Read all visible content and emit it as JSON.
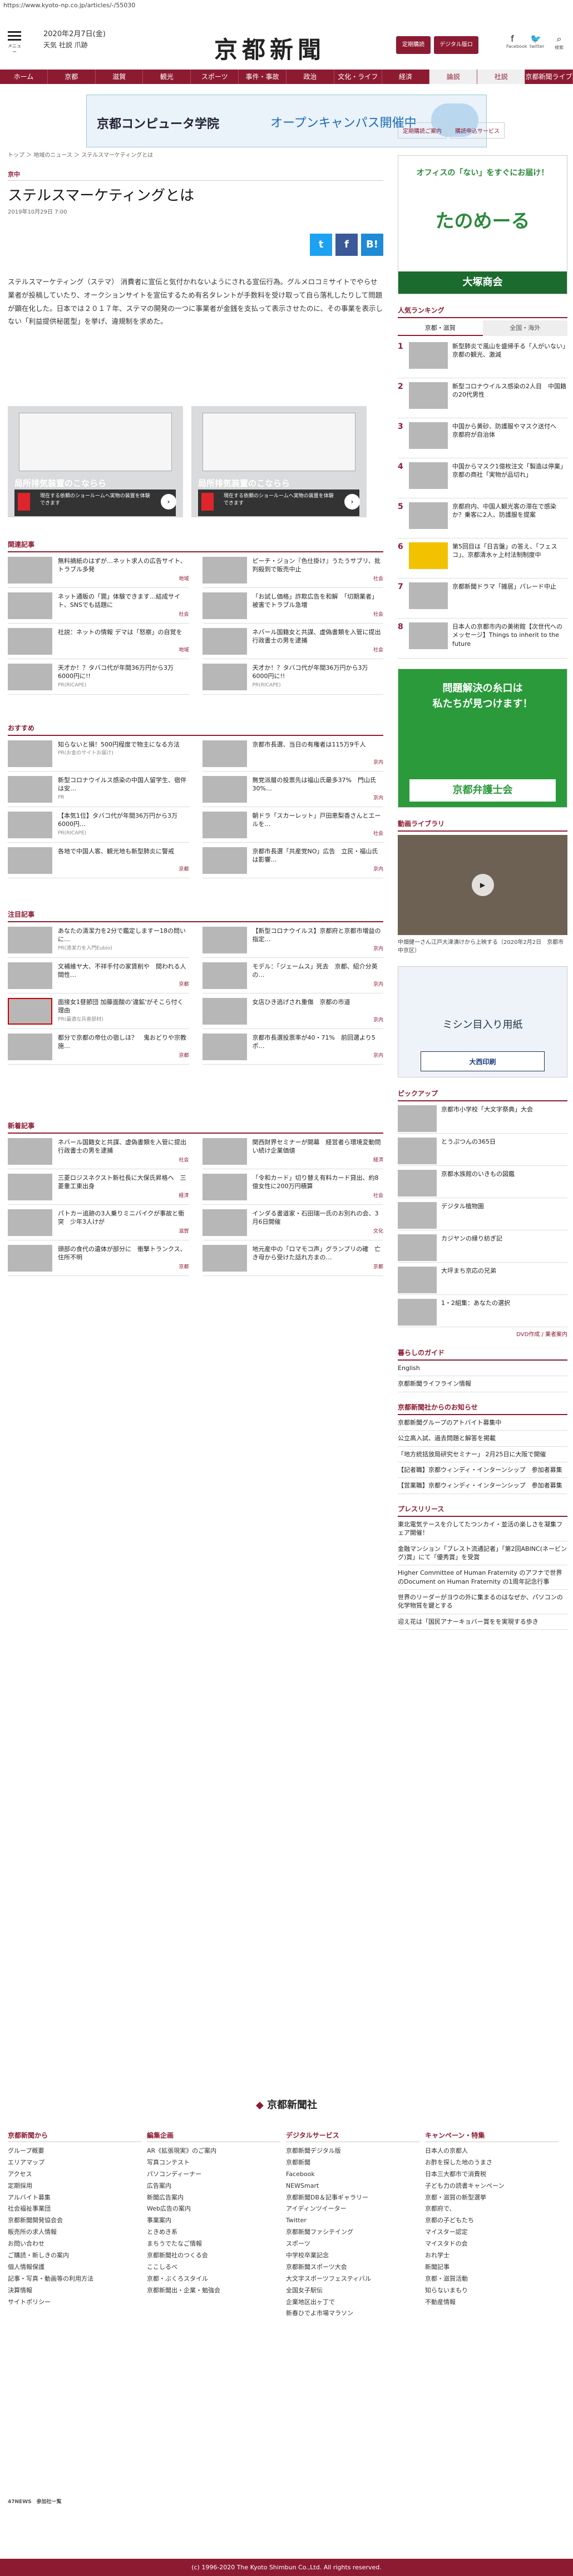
{
  "url": "https://www.kyoto-np.co.jp/articles/-/55030",
  "header": {
    "date": "2020年2月7日(金)",
    "weather": "天気 社説 爪跡",
    "logo": "京都新聞",
    "btn1": "定期購読",
    "btn2": "デジタル版ログイン",
    "menu": "メニュー",
    "icons": [
      "Facebook",
      "twitter",
      "検索"
    ]
  },
  "nav": [
    "ホーム",
    "京都",
    "滋賀",
    "観光",
    "スポーツ",
    "事件・事故",
    "政治",
    "文化・ライフ",
    "経済",
    "論説",
    "社説",
    "京都新聞ライブ"
  ],
  "banner": {
    "school": "京都コンピュータ学院",
    "event": "オープンキャンパス開催中"
  },
  "breadcrumb": "トップ ＞ 地域のニュース ＞ ステルスマーケティングとは",
  "category": "京中",
  "title": "ステルスマーケティングとは",
  "pubdate": "2019年10月29日 7:00",
  "share": [
    "t",
    "f",
    "B!"
  ],
  "body": "ステルスマーケティング（ステマ） 消費者に宣伝と気付かれないようにされる宣伝行為。グルメロコミサイトでやらせ業者が投稿していたり、オークションサイトを宣伝するため有名タレントが手数料を受け取って自ら落札したりして問題が顕在化した。日本では２０１７年、ステマの開発の一つに事業者が金銭を支払って表示させたのに、その事業を表示しない「利益提供秘匿型」を挙げ、違規制を求めた。",
  "ads": [
    {
      "title": "局所排気装置のこならら",
      "desc": "現在する依頼のショールームへ実物の装置を体験できます"
    },
    {
      "title": "局所排気装置のこならら",
      "desc": "現在する依頼のショールームへ実物の装置を体験できます"
    }
  ],
  "related_title": "関連記事",
  "related": [
    {
      "t": "無料摘紙のはずが…ネット求人の広告サイト、トラブル多発",
      "tag": "地域"
    },
    {
      "t": "ピーチ・ジョン『色仕掛け』うたうサブリ、批判殺到で販売中止",
      "tag": "社会"
    },
    {
      "t": "ネット通販の「罠」体験できます…結成サイト、SNSでも話題に",
      "tag": "社会"
    },
    {
      "t": "「お試し価格」詐欺広告を和解　「切期業者」被害でトラブル急増",
      "tag": "社会"
    },
    {
      "t": "社説：ネットの情報 デマは「怒察」の自覚を",
      "tag": "地域"
    },
    {
      "t": "ネバール国籍女と共謀、虚偽書類を入管に提出　行政書士の男を逮捕",
      "tag": "社会"
    },
    {
      "t": "天才か！？タバコ代が年間36万円から3万6000円に!!",
      "tag": "PR(RICAPE)"
    },
    {
      "t": "天才か！？タバコ代が年間36万円から3万6000円に!!",
      "tag": "PR(RICAPE)"
    }
  ],
  "osusume_title": "おすすめ",
  "osusume": [
    {
      "t": "知らないと損！500円程度で物主になる方法",
      "tag": "PR(お金のサイトお届け)"
    },
    {
      "t": "京都市長選、当日の有権者は115万9千人",
      "tag": "京内"
    },
    {
      "t": "新型コロナウイルス感染の中国人留学生、宿伴は安…",
      "tag": "PR"
    },
    {
      "t": "無党派層の投票先は福山氏最多37%　門山氏30%…",
      "tag": "京内"
    },
    {
      "t": "【本気1位】タバコ代が年間36万円から3万6000円…",
      "tag": "PR(RICAPE)"
    },
    {
      "t": "朝ドラ「スカーレット」戸田恵梨香さんとエールを…",
      "tag": "社会"
    },
    {
      "t": "各地で中国人客、観光地も新型肺炎に警戒",
      "tag": "京都"
    },
    {
      "t": "京都市長選「共産党NO」広告　立民・福山氏は影響…",
      "tag": "京内"
    }
  ],
  "chumoku_title": "注目記事",
  "chumoku": [
    {
      "t": "あなたの清潔力を2分で鑑定しますー18の問いに…",
      "tag": "PR(清潔力を入門Eubio)"
    },
    {
      "t": "【新型コロナウイルス】京都府と京都市増益の指定…",
      "tag": "京内"
    },
    {
      "t": "文補維ヤ大、不祥手付の家賃削や　間われる人間性…",
      "tag": "京都"
    },
    {
      "t": "モデル：「ジェームス」死去　京都、紹介分英の…",
      "tag": "京内"
    },
    {
      "t": "面接女1昼節団 加藤面酸の'違鉱'がそこら付く理由",
      "tag": "PR(最適な兵喜部材)"
    },
    {
      "t": "女店ひき逃げされ重傷　京都の市道",
      "tag": "京内"
    },
    {
      "t": "都分で京都の帝仕の宿しほ？　鬼おどりや宗教施…",
      "tag": "京都"
    },
    {
      "t": "京都市長選投票率が40・71%　前回選より5ポ…",
      "tag": "京内"
    }
  ],
  "shinchaku_title": "新着記事",
  "shinchaku": [
    {
      "t": "ネバール国籍女と共謀、虚偽書類を入管に提出　行政書士の男を逮捕",
      "tag": "社会"
    },
    {
      "t": "関西財界セミナーが開幕　経営者ら環境変動問い続け企業価値",
      "tag": "経済"
    },
    {
      "t": "三菱ロジスネクスト新社長に大保氏昇格へ　三菱重工東出身",
      "tag": "経済"
    },
    {
      "t": "「令和カード」切り替え有料カード貸出、約8億女性に200万円積算",
      "tag": "社会"
    },
    {
      "t": "パトカー追跡の3人乗りミニバイクが事故と衝突　少年3人けが",
      "tag": "滋賀"
    },
    {
      "t": "インダる書道家・石田瑞一氏のお別れの会、3月6日開催",
      "tag": "文化"
    },
    {
      "t": "頭部の食代の遺体が部分に　衝撃トランクス、住所不明",
      "tag": "京都"
    },
    {
      "t": "地元産中の「ロマモコ声」グランプリの確　亡き母から受けた話れ方まの…",
      "tag": "京都"
    }
  ],
  "side": {
    "btns": [
      "定期購読ご案内",
      "購読申込サービス"
    ],
    "ad1": {
      "top": "オフィスの「ない」をすぐにお届け！",
      "brand": "たのめーる",
      "corp": "大塚商会"
    },
    "rank_title": "人気ランキング",
    "rank_tabs": [
      "京都・滋賀",
      "全国・海外"
    ],
    "rank": [
      "新型肺炎で風山を盛帰手る「人がいない」　京都の観光、激減",
      "新型コロナウイルス感染の2人目　中国籍の20代男性",
      "中国から黄砂、防護服やマスク送付へ　京都府が自治体",
      "中国からマスク1億枚注文「製造は停業」京都の商社「実物が品切れ」",
      "京都府内、中国人観光客の滞在で感染か？乗客に2人、防護服を提案",
      "第5回目は「日吉盤」の答え、「フェスコ」、京都清水ヶ上村法制制度中",
      "京都新聞ドラマ「雑居」パレード中止",
      "日本人の京都市内の美術館【次世代へのメッセージ】Things to inherit to the future"
    ],
    "ad2": {
      "t1": "問題解決の糸口は",
      "t2": "私たちが見つけます！",
      "t3": "京都弁護士会"
    },
    "video_title": "動画ライブラリ",
    "video_cap": "中畑健一さん江戸大津漬けから上映する（2020年2月2日　京都市中京区）",
    "ad3": {
      "t1": "ミシン目入り用紙",
      "t2": "大西印刷"
    },
    "pickup_title": "ピックアップ",
    "pickup": [
      "京都市小学校「大文字祭典」大会",
      "とうぷつんの365日",
      "京都水族館のいきもの図鑑",
      "デジタル植物園",
      "カジヤンの縁り紡ぎ記",
      "大坪まち京応の兄弟",
      "1・2組集：あなたの選択"
    ],
    "pickup_extra": "DVD作成 / 業者案内",
    "kurashi_title": "暮らしのガイド",
    "kurashi": [
      "English",
      "京都新聞ライフライン情報"
    ],
    "kyoto_title": "京都新聞社からのお知らせ",
    "kyoto": [
      "京都新聞グループのアトバイト募集中",
      "公立高入試、過去問題と解答を掲載",
      "「地方統括放局研究セミナー」 2月25日に大阪で開催",
      "【記者職】京都ウィンディ・インターンシップ　参加者募集",
      "【営業職】京都ウィンディ・インターンシップ　参加者募集"
    ],
    "press_title": "プレスリリース",
    "press": [
      "東北電気テースを介してたつンカイ・並活の楽しさを凝集フェア開催！",
      "金融マンション「ブレスト流通記者」「第2回ABINC(ネービング)賞」にて「優秀賞」を受賞",
      "Higher Committee of Human Fraternity のアフナで世界のDocument on Human Fraternity の1周年記念行事",
      "世界のリーダーがヨウの外に集まるのはなぜか、パソコンの化学物質を鍵とする",
      "迎え花は「国民アナーキョバー賞をを実現する歩き"
    ]
  },
  "footer": {
    "brand": "京都新聞社",
    "cols": [
      {
        "h": "京都新聞から",
        "items": [
          "グループ概要",
          "エリアマップ",
          "アクセス",
          "定期採用",
          "アルバイト募集",
          "社会福祉事業団",
          "京都新聞開発協会会",
          "販売所の求人情報",
          "お問い合わせ",
          "ご購読・新しきの案内",
          "個人情報保護",
          "記事・写真・動画等の利用方法",
          "決算情報",
          "サイトポリシー"
        ]
      },
      {
        "h": "編集企画",
        "items": [
          "AR《拡張現実》のご案内",
          "写真コンテスト",
          "パソコンディーナー",
          "広告案内",
          "新聞広告案内",
          "Web広告の案内",
          "事業案内",
          "ときめき系",
          "まちうでたなご情報",
          "京都新聞社のつくる会",
          "ここしるべ",
          "京都・ぶくろスタイル",
          "京都新聞出・企業・勉強会"
        ]
      },
      {
        "h": "デジタルサービス",
        "items": [
          "京都新聞デジタル版",
          "京都新聞",
          "Facebook",
          "NEWSmart",
          "京都新聞DB＆記事ギャラリー",
          "アイディンツイーター",
          "Twitter",
          "京都新聞ファシテイング",
          "スポーツ",
          "中学校卒業記念",
          "京都新聞スポーツ大会",
          "大文字スポーツフェスティバル",
          "全国女子駅伝",
          "企業地区出ヶ丁で",
          "新春ひでよ市場マラソン"
        ]
      },
      {
        "h": "キャンペーン・特集",
        "items": [
          "日本人の京都人",
          "お酢を探した地のうまさ",
          "日本三大都市で消費税",
          "子ども力の読書キャンペーン",
          "京都・滋賀の新型選挙",
          "京都府で、",
          "京都の子どもたち",
          "マイスター認定",
          "マイスタドの会",
          "おれ学士",
          "新聞記事",
          "京都・滋賀活動",
          "知らないまもり",
          "不動産情報"
        ]
      }
    ],
    "news47": "47NEWS　参加社一覧",
    "copyright": "(c) 1996-2020 The Kyoto Shimbun Co.,Ltd. All rights reserved."
  }
}
